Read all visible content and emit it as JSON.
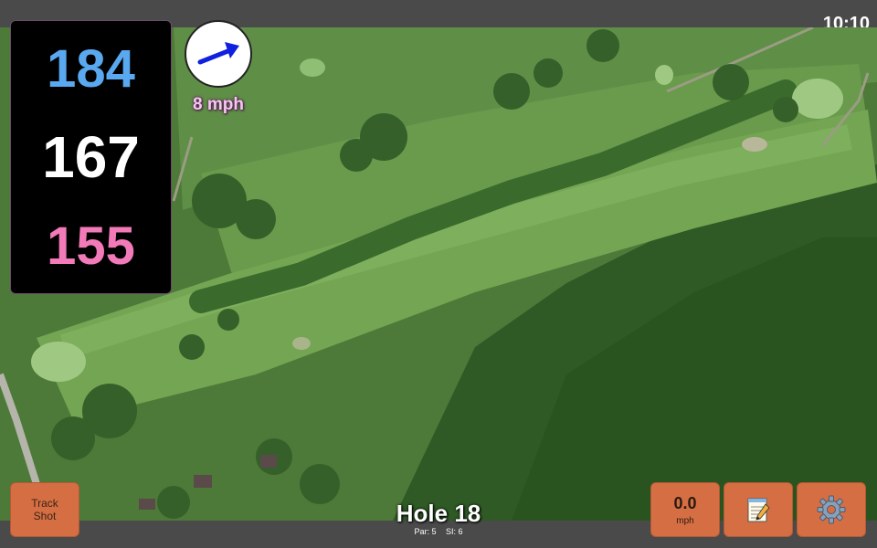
{
  "status_bar": {
    "time": "10:10"
  },
  "yardages": {
    "back": "184",
    "center": "167",
    "front": "155"
  },
  "wind": {
    "speed_label": "8 mph",
    "direction_icon": "arrow-up-right-icon"
  },
  "buttons": {
    "track_shot": {
      "line1": "Track",
      "line2": "Shot"
    },
    "speed": {
      "value": "0.0",
      "unit": "mph"
    },
    "notes": {
      "icon": "notepad-icon"
    },
    "settings": {
      "icon": "gear-icon"
    }
  },
  "hole": {
    "title": "Hole 18",
    "par": "Par: 5",
    "si": "SI: 6"
  },
  "colors": {
    "back_yardage": "#5aa8f0",
    "center_yardage": "#ffffff",
    "front_yardage": "#f27ab8",
    "button": "#d56f43",
    "wind_arrow": "#1020e0"
  }
}
